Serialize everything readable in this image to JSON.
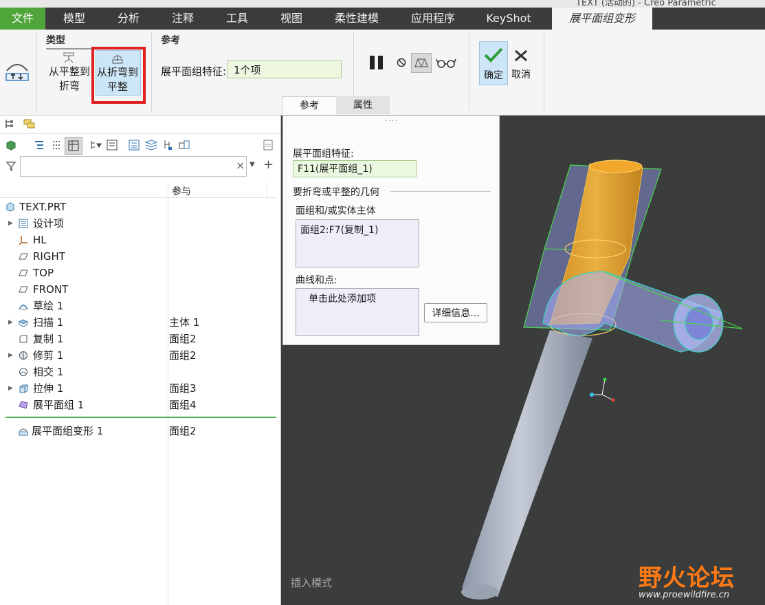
{
  "window": {
    "title": "TEXT (活动的) - Creo Parametric"
  },
  "menu": {
    "items": [
      "文件",
      "模型",
      "分析",
      "注释",
      "工具",
      "视图",
      "柔性建模",
      "应用程序",
      "KeyShot",
      "展平面组变形"
    ]
  },
  "ribbon": {
    "type_group_title": "类型",
    "flat_to_bend_line1": "从平整到",
    "flat_to_bend_line2": "折弯",
    "bend_to_flat_line1": "从折弯到",
    "bend_to_flat_line2": "平整",
    "ref_group_title": "参考",
    "feature_label": "展平面组特征:",
    "feature_value": "1个项",
    "ok_label": "确定",
    "cancel_label": "取消",
    "subtab_ref": "参考",
    "subtab_props": "属性"
  },
  "tree": {
    "column_ref": "参与",
    "filter_placeholder": "",
    "rows": [
      {
        "name": "TEXT.PRT",
        "ref": ""
      },
      {
        "name": "设计项",
        "ref": ""
      },
      {
        "name": "HL",
        "ref": ""
      },
      {
        "name": "RIGHT",
        "ref": ""
      },
      {
        "name": "TOP",
        "ref": ""
      },
      {
        "name": "FRONT",
        "ref": ""
      },
      {
        "name": "草绘 1",
        "ref": ""
      },
      {
        "name": "扫描 1",
        "ref": "主体 1"
      },
      {
        "name": "复制 1",
        "ref": "面组2"
      },
      {
        "name": "修剪 1",
        "ref": "面组2"
      },
      {
        "name": "相交 1",
        "ref": ""
      },
      {
        "name": "拉伸 1",
        "ref": "面组3"
      },
      {
        "name": "展平面组 1",
        "ref": "面组4"
      },
      {
        "name": "展平面组变形 1",
        "ref": "面组2"
      }
    ]
  },
  "panel": {
    "feature_label": "展平面组特征:",
    "feature_value": "F11(展平面组_1)",
    "geom_section": "要折弯或平整的几何",
    "quilt_label": "面组和/或实体主体",
    "quilt_value": "面组2:F7(复制_1)",
    "curves_label": "曲线和点:",
    "curves_placeholder": "单击此处添加项",
    "details_button": "详细信息..."
  },
  "viewport": {
    "mode_text": "插入模式",
    "watermark_cn": "野火论坛",
    "watermark_url": "www.proewildfire.cn"
  },
  "colors": {
    "menu_bg": "#3b3b3b",
    "file_tab": "#4fa43a",
    "viewport_bg": "#3a3d3c",
    "highlight": "#cde6f7",
    "red_frame": "#e02020"
  }
}
